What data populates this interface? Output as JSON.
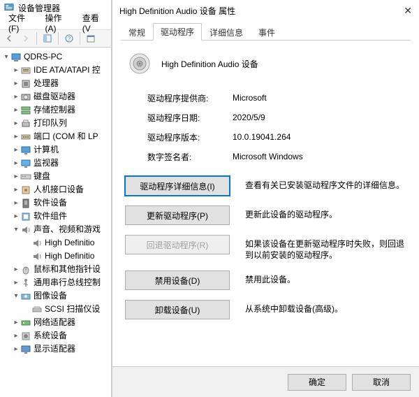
{
  "dm": {
    "title": "设备管理器",
    "menu": {
      "file": "文件(F)",
      "action": "操作(A)",
      "view": "查看(V"
    },
    "root": "QDRS-PC",
    "items": [
      {
        "label": "IDE ATA/ATAPI 控",
        "icon": "ide"
      },
      {
        "label": "处理器",
        "icon": "cpu"
      },
      {
        "label": "磁盘驱动器",
        "icon": "disk"
      },
      {
        "label": "存储控制器",
        "icon": "storage"
      },
      {
        "label": "打印队列",
        "icon": "printer"
      },
      {
        "label": "端口 (COM 和 LP",
        "icon": "port"
      },
      {
        "label": "计算机",
        "icon": "computer"
      },
      {
        "label": "监视器",
        "icon": "monitor"
      },
      {
        "label": "键盘",
        "icon": "keyboard"
      },
      {
        "label": "人机接口设备",
        "icon": "hid"
      },
      {
        "label": "软件设备",
        "icon": "softdev"
      },
      {
        "label": "软件组件",
        "icon": "softcomp"
      },
      {
        "label": "声音、视频和游戏",
        "icon": "sound",
        "expanded": true,
        "children": [
          {
            "label": "High Definitio",
            "icon": "speaker"
          },
          {
            "label": "High Definitio",
            "icon": "speaker"
          }
        ]
      },
      {
        "label": "鼠标和其他指针设",
        "icon": "mouse"
      },
      {
        "label": "通用串行总线控制",
        "icon": "usb"
      },
      {
        "label": "图像设备",
        "icon": "imaging",
        "expanded": true,
        "children": [
          {
            "label": "SCSI 扫描仪设",
            "icon": "scanner"
          }
        ]
      },
      {
        "label": "网络适配器",
        "icon": "network"
      },
      {
        "label": "系统设备",
        "icon": "system"
      },
      {
        "label": "显示适配器",
        "icon": "display"
      }
    ]
  },
  "dlg": {
    "title": "High Definition Audio 设备 属性",
    "tabs": [
      "常规",
      "驱动程序",
      "详细信息",
      "事件"
    ],
    "active_tab": 1,
    "device_name": "High Definition Audio 设备",
    "info": [
      {
        "label": "驱动程序提供商:",
        "value": "Microsoft"
      },
      {
        "label": "驱动程序日期:",
        "value": "2020/5/9"
      },
      {
        "label": "驱动程序版本:",
        "value": "10.0.19041.264"
      },
      {
        "label": "数字签名者:",
        "value": "Microsoft Windows"
      }
    ],
    "buttons": [
      {
        "label": "驱动程序详细信息(I)",
        "desc": "查看有关已安装驱动程序文件的详细信息。",
        "focus": true
      },
      {
        "label": "更新驱动程序(P)",
        "desc": "更新此设备的驱动程序。"
      },
      {
        "label": "回退驱动程序(R)",
        "desc": "如果该设备在更新驱动程序时失败，则回退到以前安装的驱动程序。",
        "disabled": true
      },
      {
        "label": "禁用设备(D)",
        "desc": "禁用此设备。"
      },
      {
        "label": "卸载设备(U)",
        "desc": "从系统中卸载设备(高级)。"
      }
    ],
    "footer": {
      "ok": "确定",
      "cancel": "取消"
    }
  }
}
